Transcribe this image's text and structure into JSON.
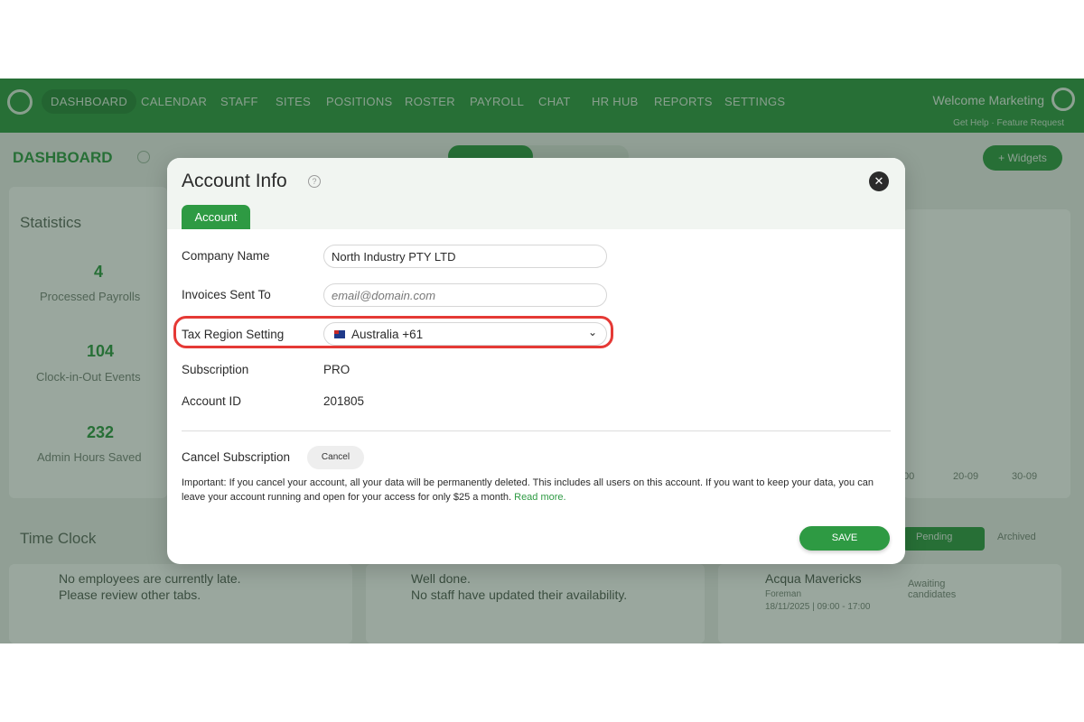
{
  "app": {
    "nav": [
      "DASHBOARD",
      "CALENDAR",
      "STAFF",
      "SITES",
      "POSITIONS",
      "ROSTER",
      "PAYROLL",
      "CHAT",
      "HR HUB",
      "REPORTS",
      "SETTINGS"
    ],
    "welcome": "Welcome Marketing",
    "sub_links": "Get Help  ·  Feature Request",
    "dashboard_title": "DASHBOARD",
    "widgets_button": "+ Widgets",
    "statistics_title": "Statistics",
    "stats": [
      {
        "value": "4",
        "label": "Processed Payrolls"
      },
      {
        "value": "104",
        "label": "Clock-in-Out Events"
      },
      {
        "value": "232",
        "label": "Admin Hours Saved"
      }
    ],
    "time_clock_title": "Time Clock",
    "late_msg_1": "No employees are currently late.",
    "late_msg_2": "Please review other tabs.",
    "avail_msg_1": "Well done.",
    "avail_msg_2": "No staff have updated their availability.",
    "pending_tab": "Pending",
    "archived_tab": "Archived",
    "shift_site": "Acqua Mavericks",
    "shift_role": "Foreman",
    "shift_time": "18/11/2025 | 09:00 - 17:00",
    "shift_status": "Awaiting candidates",
    "chart_ticks": [
      "00",
      "20-09",
      "30-09"
    ]
  },
  "modal": {
    "title": "Account Info",
    "help_glyph": "?",
    "close_glyph": "✕",
    "tab": "Account",
    "company_label": "Company Name",
    "company_value": "North Industry PTY LTD",
    "invoices_label": "Invoices Sent To",
    "invoices_placeholder": "email@domain.com",
    "tax_label": "Tax Region Setting",
    "tax_value": "Australia +61",
    "subscription_label": "Subscription",
    "subscription_value": "PRO",
    "account_id_label": "Account ID",
    "account_id_value": "201805",
    "cancel_label": "Cancel Subscription",
    "cancel_button": "Cancel",
    "notice": "Important: If you cancel your account, all your data will be permanently deleted. This includes all users on this account. If you want to keep your data, you can leave your account running and open for your access for only $25 a month.",
    "read_more": "Read more.",
    "save_button": "SAVE"
  },
  "colors": {
    "brand_green": "#2e9a43",
    "highlight_red": "#e53935"
  }
}
